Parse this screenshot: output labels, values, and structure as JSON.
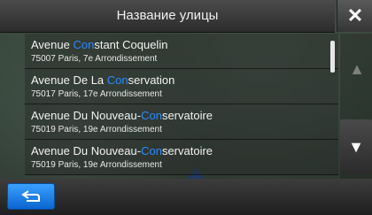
{
  "header": {
    "title": "Название улицы",
    "close_label": "✕"
  },
  "list": {
    "items": [
      {
        "title_pre": "Avenue ",
        "title_hl": "Con",
        "title_post": "stant Coquelin",
        "subtitle": "75007 Paris, 7e Arrondissement"
      },
      {
        "title_pre": "Avenue De La ",
        "title_hl": "Con",
        "title_post": "servation",
        "subtitle": "75017 Paris, 17e Arrondissement"
      },
      {
        "title_pre": "Avenue Du Nouveau-",
        "title_hl": "Con",
        "title_post": "servatoire",
        "subtitle": "75019 Paris, 19e Arrondissement"
      },
      {
        "title_pre": "Avenue Du Nouveau-",
        "title_hl": "Con",
        "title_post": "servatoire",
        "subtitle": "75019 Paris, 19e Arrondissement"
      }
    ]
  },
  "nav": {
    "up_icon": "▲",
    "down_icon": "▼"
  },
  "colors": {
    "highlight": "#2a8cff",
    "back_button": "#1a7ff0"
  }
}
